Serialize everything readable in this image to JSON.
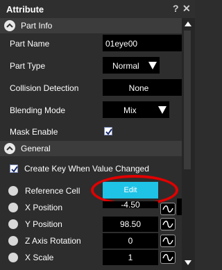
{
  "window": {
    "title": "Attribute",
    "help_glyph": "?",
    "close_glyph": "✕"
  },
  "part_info": {
    "header": "Part Info",
    "part_name_label": "Part Name",
    "part_name_value": "01eye00",
    "part_type_label": "Part Type",
    "part_type_value": "Normal",
    "collision_label": "Collision Detection",
    "collision_value": "None",
    "blending_label": "Blending Mode",
    "blending_value": "Mix",
    "mask_label": "Mask Enable",
    "mask_checked": true
  },
  "general": {
    "header": "General",
    "create_key_label": "Create Key When Value Changed",
    "create_key_checked": true,
    "reference_cell_label": "Reference Cell",
    "edit_label": "Edit",
    "params": [
      {
        "label": "X Position",
        "value": "-4.50"
      },
      {
        "label": "Y Position",
        "value": "98.50"
      },
      {
        "label": "Z Axis Rotation",
        "value": "0"
      },
      {
        "label": "X Scale",
        "value": "1"
      }
    ]
  },
  "colors": {
    "accent": "#1ec3e6",
    "highlight_ring": "#e00000",
    "background": "#2d2d2d",
    "section": "#3c3c3c"
  }
}
